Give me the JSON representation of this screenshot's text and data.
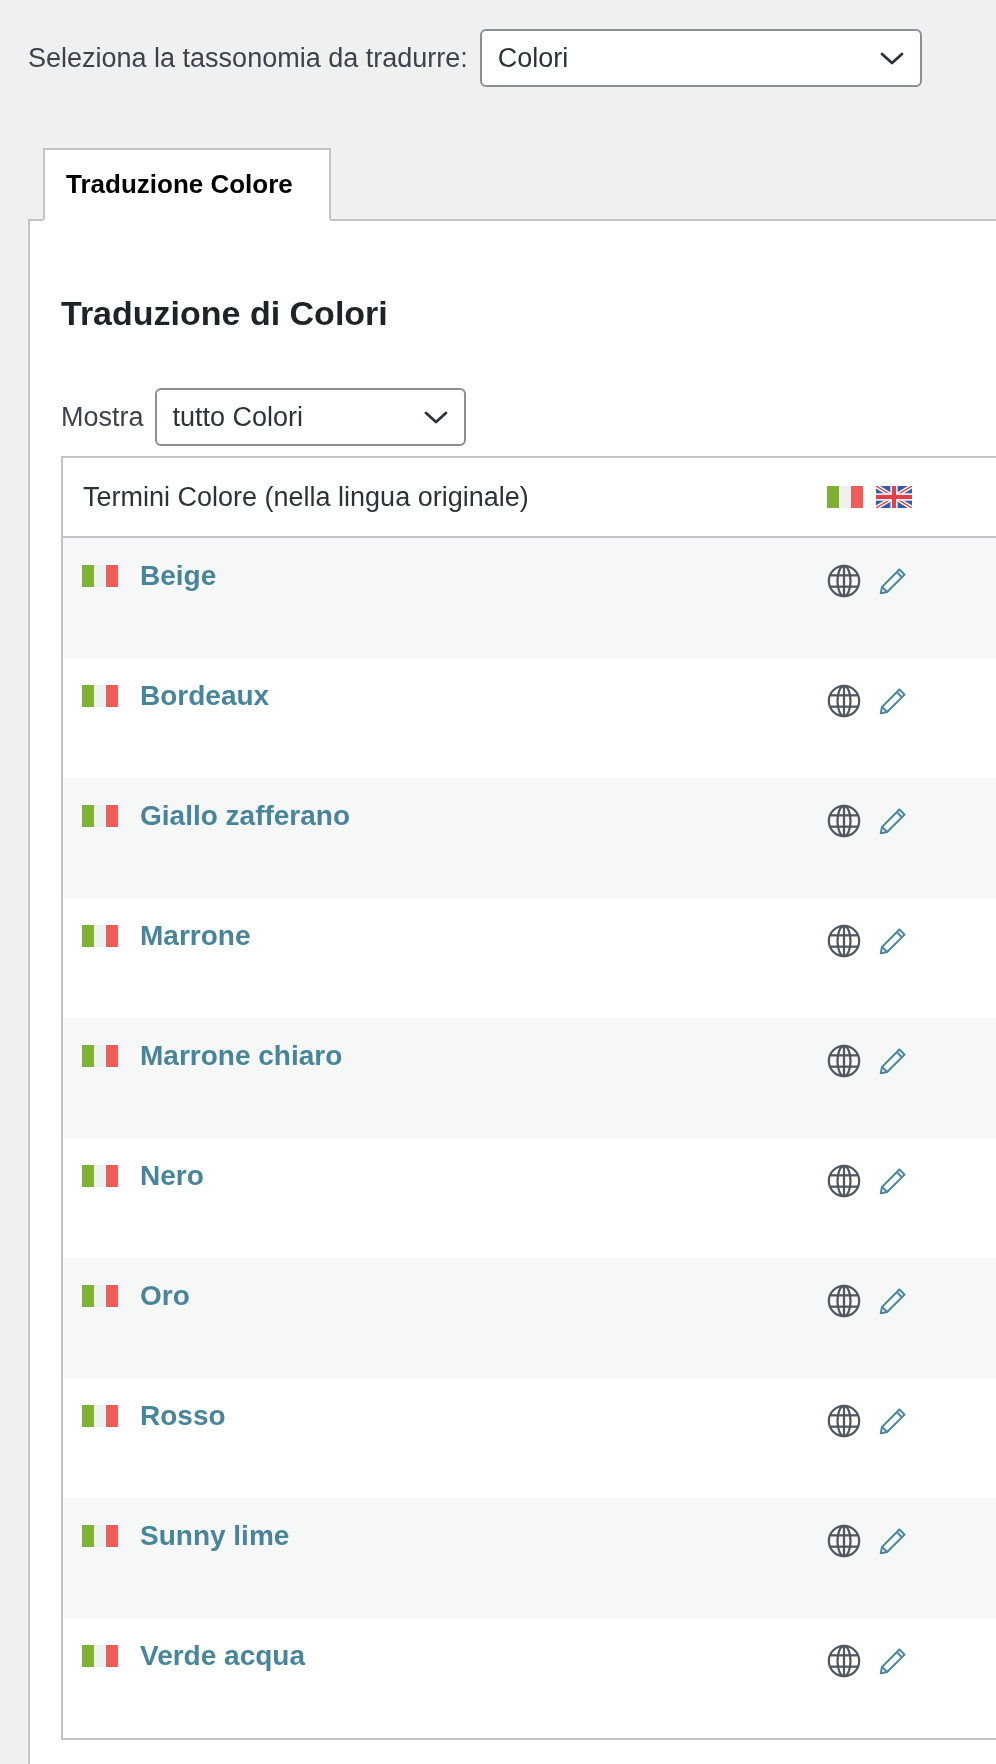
{
  "taxonomy_select": {
    "label": "Seleziona la tassonomia da tradurre:",
    "value": "Colori"
  },
  "tabs": [
    {
      "label": "Traduzione Colore",
      "selected": true
    }
  ],
  "panel": {
    "heading": "Traduzione di Colori",
    "filter": {
      "label": "Mostra",
      "value": "tutto Colori"
    },
    "table": {
      "term_column": {
        "label": "Termini Colore (nella lingua originale)"
      },
      "rows": [
        {
          "term": "Beige"
        },
        {
          "term": "Bordeaux"
        },
        {
          "term": "Giallo zafferano"
        },
        {
          "term": "Marrone"
        },
        {
          "term": "Marrone chiaro"
        },
        {
          "term": "Nero"
        },
        {
          "term": "Oro"
        },
        {
          "term": "Rosso"
        },
        {
          "term": "Sunny lime"
        },
        {
          "term": "Verde acqua"
        }
      ]
    }
  }
}
